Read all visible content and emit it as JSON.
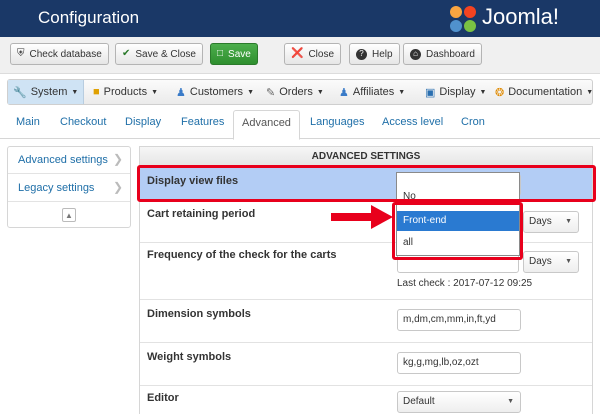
{
  "header": {
    "title": "Configuration",
    "logo_text": "Joomla!"
  },
  "toolbar": {
    "check_database": "Check database",
    "save_close": "Save & Close",
    "save": "Save",
    "close": "Close",
    "help": "Help",
    "dashboard": "Dashboard"
  },
  "menubar": {
    "items": [
      {
        "label": "System",
        "icon": "wrench-icon"
      },
      {
        "label": "Products",
        "icon": "box-icon"
      },
      {
        "label": "Customers",
        "icon": "users-icon"
      },
      {
        "label": "Orders",
        "icon": "clipboard-icon"
      },
      {
        "label": "Affiliates",
        "icon": "affiliates-icon"
      },
      {
        "label": "Display",
        "icon": "display-icon"
      },
      {
        "label": "Documentation",
        "icon": "lifebuoy-icon"
      }
    ]
  },
  "tabs": [
    "Main",
    "Checkout",
    "Display",
    "Features",
    "Advanced",
    "Languages",
    "Access level",
    "Cron"
  ],
  "active_tab": "Advanced",
  "sidebar": {
    "items": [
      "Advanced settings",
      "Legacy settings"
    ]
  },
  "panel": {
    "title": "ADVANCED SETTINGS",
    "display_view_files": {
      "label": "Display view files",
      "value": "No"
    },
    "cart_retaining": {
      "label": "Cart retaining period",
      "unit": "Days"
    },
    "frequency": {
      "label": "Frequency of the check for the carts",
      "unit": "Days",
      "last_check": "Last check : 2017-07-12 09:25"
    },
    "dimension": {
      "label": "Dimension symbols",
      "value": "m,dm,cm,mm,in,ft,yd"
    },
    "weight": {
      "label": "Weight symbols",
      "value": "kg,g,mg,lb,oz,ozt"
    },
    "editor": {
      "label": "Editor",
      "value": "Default"
    }
  },
  "dropdown": {
    "options": [
      "No",
      "Front-end",
      "all"
    ],
    "selected": "Front-end"
  },
  "colors": {
    "header_bg": "#1a3867",
    "highlight": "#e8001c",
    "selected_option": "#2a7ad1",
    "save_button": "#3d9e3d",
    "row_highlight": "#b3cdf5"
  }
}
